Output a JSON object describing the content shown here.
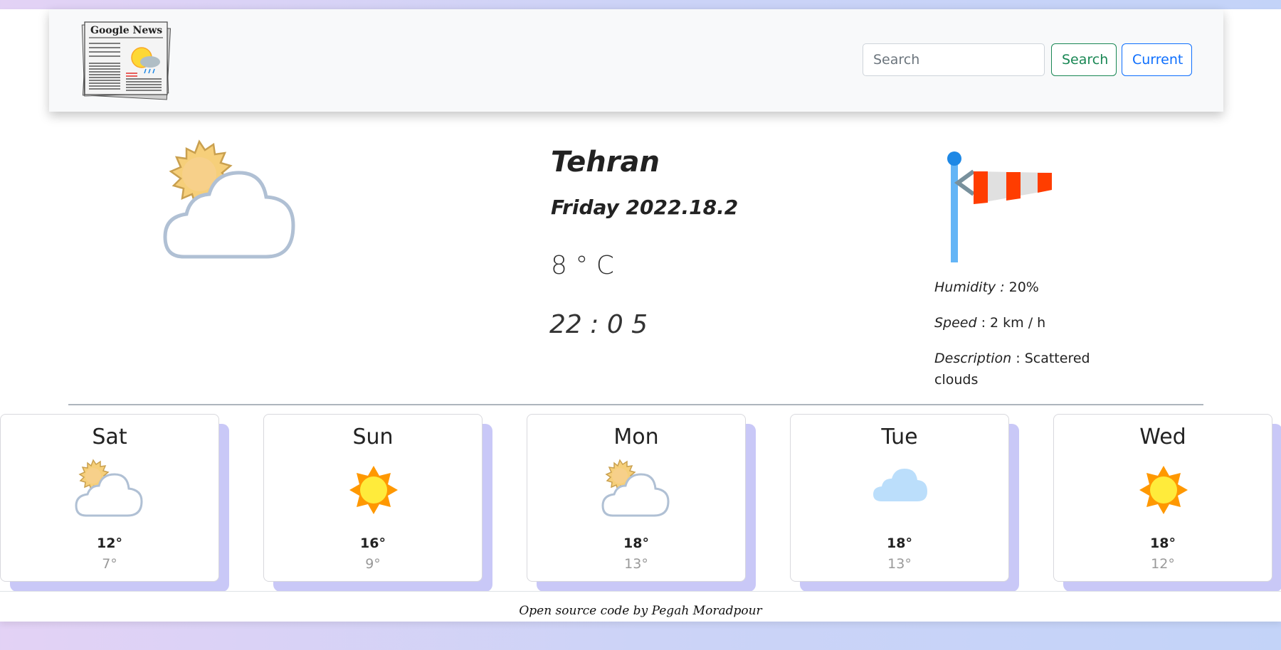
{
  "navbar": {
    "logo_text": "Google News",
    "search_placeholder": "Search",
    "search_button": "Search",
    "current_button": "Current"
  },
  "weather": {
    "icon": "partly-cloudy-icon",
    "city": "Tehran",
    "date": "Friday 2022.18.2",
    "temperature": "8 ° C",
    "time": "22 : 0 5",
    "wind_icon": "windsock-icon",
    "humidity_label": "Humidity :",
    "humidity_value": " 20%",
    "speed_label": "Speed",
    "speed_value": " : 2 km / h",
    "description_label": "Description",
    "description_value": " : Scattered clouds"
  },
  "forecast": [
    {
      "day": "Sat",
      "icon": "partly-cloudy-icon",
      "high": "12°",
      "low": "7°"
    },
    {
      "day": "Sun",
      "icon": "sun-icon",
      "high": "16°",
      "low": "9°"
    },
    {
      "day": "Mon",
      "icon": "partly-cloudy-icon",
      "high": "18°",
      "low": "13°"
    },
    {
      "day": "Tue",
      "icon": "cloud-icon",
      "high": "18°",
      "low": "13°"
    },
    {
      "day": "Wed",
      "icon": "sun-icon",
      "high": "18°",
      "low": "12°"
    }
  ],
  "footer": {
    "text": "Open source code by Pegah Moradpour"
  },
  "colors": {
    "search_button": "#198754",
    "current_button": "#0d6efd",
    "card_shadow": "#c9c8f7",
    "sun": "#ffeb3b",
    "sun_rays": "#ff9800",
    "windsock_red": "#ff3d00",
    "pole": "#64b5f6"
  }
}
